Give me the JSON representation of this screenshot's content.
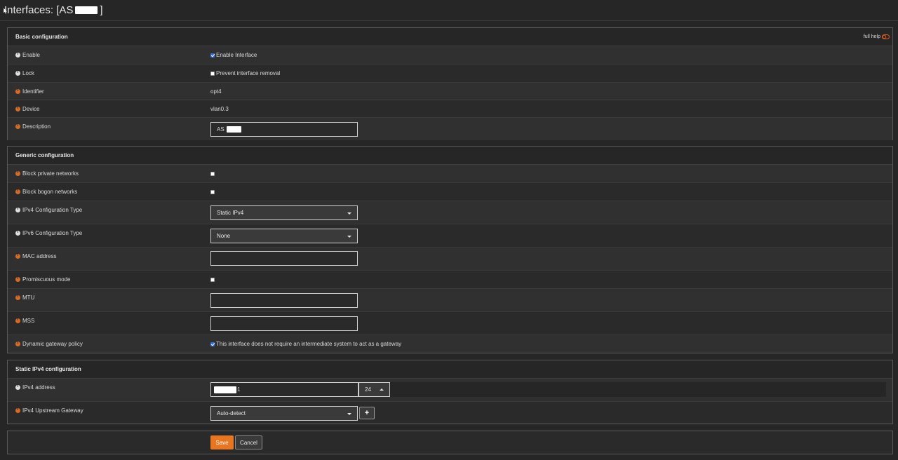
{
  "page": {
    "title_prefix": "Interfaces: [AS",
    "title_suffix": "]"
  },
  "basic": {
    "title": "Basic configuration",
    "full_help": "full help",
    "enable": {
      "label": "Enable",
      "checkbox_label": "Enable Interface",
      "checked": true
    },
    "lock": {
      "label": "Lock",
      "checkbox_label": "Prevent interface removal",
      "checked": false
    },
    "identifier": {
      "label": "Identifier",
      "value": "opt4"
    },
    "device": {
      "label": "Device",
      "value": "vlan0.3"
    },
    "description": {
      "label": "Description",
      "value": "AS"
    }
  },
  "generic": {
    "title": "Generic configuration",
    "block_private": {
      "label": "Block private networks",
      "checked": false
    },
    "block_bogon": {
      "label": "Block bogon networks",
      "checked": false
    },
    "ipv4_type": {
      "label": "IPv4 Configuration Type",
      "value": "Static IPv4"
    },
    "ipv6_type": {
      "label": "IPv6 Configuration Type",
      "value": "None"
    },
    "mac": {
      "label": "MAC address",
      "value": ""
    },
    "promiscuous": {
      "label": "Promiscuous mode",
      "checked": false
    },
    "mtu": {
      "label": "MTU",
      "value": ""
    },
    "mss": {
      "label": "MSS",
      "value": ""
    },
    "dyn_gw": {
      "label": "Dynamic gateway policy",
      "checkbox_label": "This interface does not require an intermediate system to act as a gateway",
      "checked": true
    }
  },
  "static_ipv4": {
    "title": "Static IPv4 configuration",
    "address": {
      "label": "IPv4 address",
      "value_suffix": "1",
      "prefix": "24"
    },
    "gateway": {
      "label": "IPv4 Upstream Gateway",
      "value": "Auto-detect"
    }
  },
  "actions": {
    "save": "Save",
    "cancel": "Cancel"
  },
  "colors": {
    "accent": "#e8751f",
    "info_orange": "#d86b22",
    "background": "#262626"
  },
  "icons": [
    "info-icon",
    "toggle-icon",
    "chevron-down-icon",
    "chevron-up-icon",
    "plus-icon"
  ]
}
